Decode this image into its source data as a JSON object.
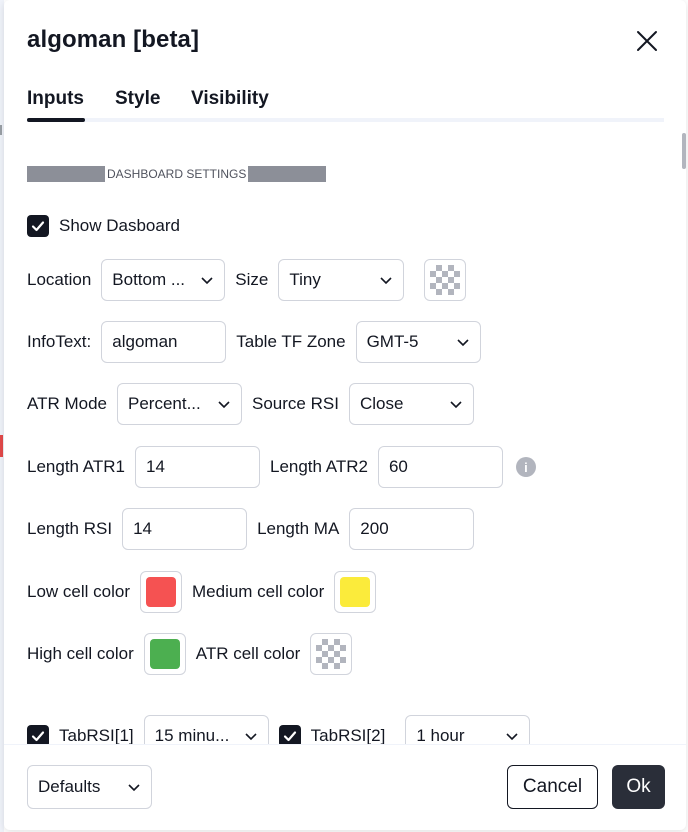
{
  "dialog": {
    "title": "algoman [beta]"
  },
  "tabs": [
    {
      "label": "Inputs",
      "active": true
    },
    {
      "label": "Style",
      "active": false
    },
    {
      "label": "Visibility",
      "active": false
    }
  ],
  "section": {
    "title": "DASHBOARD SETTINGS"
  },
  "show_dashboard": {
    "label": "Show Dasboard",
    "checked": true
  },
  "location": {
    "label": "Location",
    "value": "Bottom ..."
  },
  "size": {
    "label": "Size",
    "value": "Tiny"
  },
  "infotext": {
    "label": "InfoText:",
    "value": "algoman"
  },
  "table_tf_zone": {
    "label": "Table TF Zone",
    "value": "GMT-5"
  },
  "atr_mode": {
    "label": "ATR Mode",
    "value": "Percent..."
  },
  "source_rsi": {
    "label": "Source RSI",
    "value": "Close"
  },
  "length_atr1": {
    "label": "Length ATR1",
    "value": "14"
  },
  "length_atr2": {
    "label": "Length ATR2",
    "value": "60"
  },
  "length_rsi": {
    "label": "Length RSI",
    "value": "14"
  },
  "length_ma": {
    "label": "Length MA",
    "value": "200"
  },
  "colors": {
    "low": {
      "label": "Low cell color",
      "color": "#f55252"
    },
    "medium": {
      "label": "Medium cell color",
      "color": "#fbeb3b"
    },
    "high": {
      "label": "High cell color",
      "color": "#4caf50"
    },
    "atr": {
      "label": "ATR cell color",
      "color": "transparent"
    }
  },
  "tabrsi": [
    {
      "label": "TabRSI[1]",
      "checked": true,
      "value": "15 minu..."
    },
    {
      "label": "TabRSI[2]",
      "checked": true,
      "value": "1 hour"
    }
  ],
  "footer": {
    "defaults": "Defaults",
    "cancel": "Cancel",
    "ok": "Ok"
  },
  "icons": {
    "close": "close-icon",
    "chevron": "chevron-down-icon",
    "check": "check-icon",
    "info": "info-icon"
  }
}
